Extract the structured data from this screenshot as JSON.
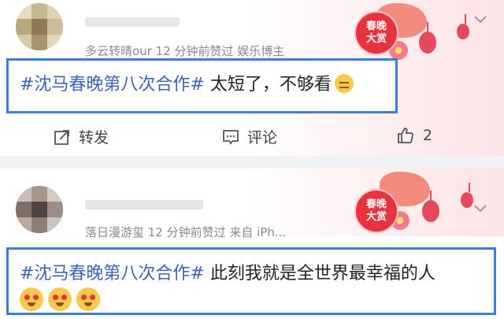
{
  "card1": {
    "meta": "多云转晴our 12 分钟前赞过   娱乐博主",
    "badge": "春晚\n大赏",
    "post": {
      "hashtag": "#沈马春晚第八次合作#",
      "text": " 太短了，不够看"
    },
    "actions": {
      "forward": "转发",
      "comment": "评论",
      "like_count": "2"
    }
  },
  "card2": {
    "meta": "落日漫游玺 12 分钟前赞过   来自 iPh...",
    "badge": "春晚\n大赏",
    "post": {
      "hashtag": "#沈马春晚第八次合作#",
      "text": " 此刻我就是全世界最幸福的人"
    }
  },
  "icons": [
    "more-icon",
    "forward-icon",
    "comment-icon",
    "like-icon",
    "sleepy-emoji",
    "heart-eyes-emoji"
  ],
  "colors": {
    "hashtag": "#3b64b4",
    "highlight": "#3b7ddd",
    "badge": "#e8323f"
  }
}
